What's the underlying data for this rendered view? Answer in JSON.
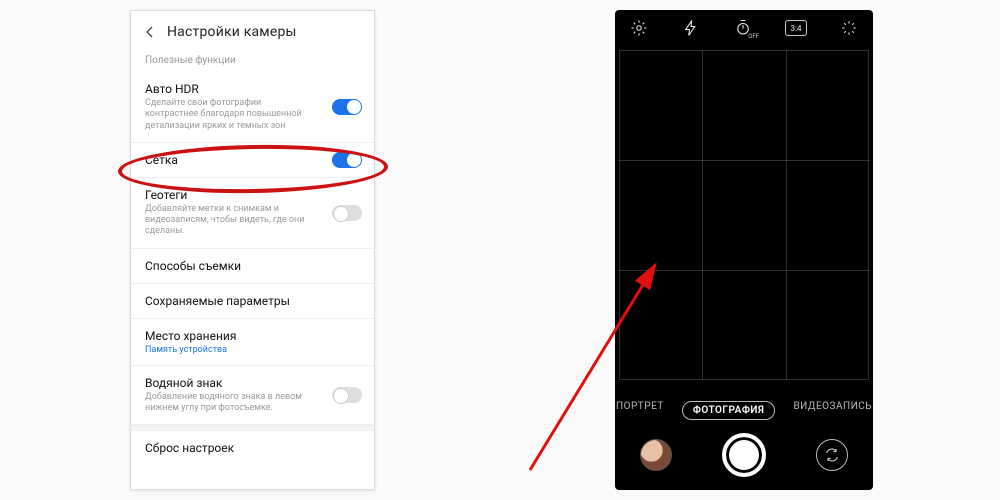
{
  "settings": {
    "title": "Настройки камеры",
    "section_label": "Полезные функции",
    "items": [
      {
        "title": "Авто HDR",
        "desc": "Сделайте свои фотографии контрастнее благодаря повышенной детализации ярких и темных зон",
        "toggle": "on"
      },
      {
        "title": "Сетка",
        "desc": "",
        "toggle": "on",
        "highlighted": true
      },
      {
        "title": "Геотеги",
        "desc": "Добавляйте метки к снимкам и видеозаписям, чтобы видеть, где они сделаны.",
        "toggle": "off"
      },
      {
        "title": "Способы съемки",
        "desc": ""
      },
      {
        "title": "Сохраняемые параметры",
        "desc": ""
      },
      {
        "title": "Место хранения",
        "sub": "Память устройства"
      },
      {
        "title": "Водяной знак",
        "desc": "Добавление водяного знака в левом нижнем углу при фотосъемке.",
        "toggle": "off"
      }
    ],
    "reset_label": "Сброс настроек"
  },
  "camera": {
    "top_icons": [
      "settings-gear-icon",
      "flash-icon",
      "timer-off-icon",
      "ratio-3-4-icon",
      "effects-icon"
    ],
    "timer_text": "OFF",
    "ratio_text": "3:4",
    "modes": {
      "left": "ПОРТРЕТ",
      "center": "ФОТОГРАФИЯ",
      "right": "ВИДЕОЗАПИСЬ"
    }
  },
  "annotation": {
    "ellipse_color": "#c11",
    "arrow_color": "#e20f0f"
  }
}
